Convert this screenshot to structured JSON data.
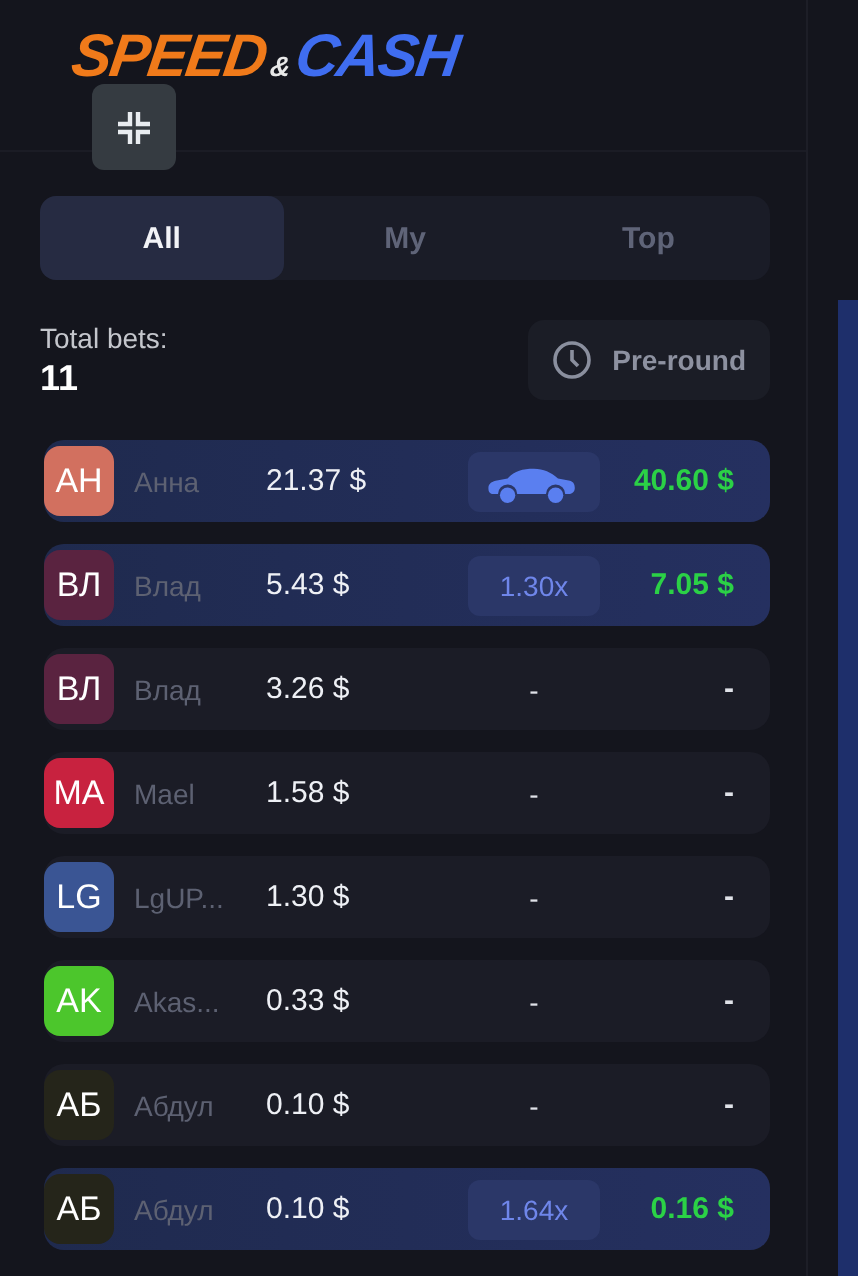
{
  "logo": {
    "left": "SPEED",
    "amp": "&",
    "right": "CASH"
  },
  "tabs": [
    {
      "label": "All",
      "selected": true
    },
    {
      "label": "My",
      "selected": false
    },
    {
      "label": "Top",
      "selected": false
    }
  ],
  "total_bets": {
    "label": "Total bets:",
    "value": "11"
  },
  "round_status": {
    "label": "Pre-round"
  },
  "bets": [
    {
      "initials": "АН",
      "color": "#d2705f",
      "name": "Анна",
      "bet": "21.37 $",
      "kind": "car",
      "payout": "40.60 $",
      "won": true
    },
    {
      "initials": "ВЛ",
      "color": "#5a2340",
      "name": "Влад",
      "bet": "5.43 $",
      "kind": "multiplier",
      "multiplier": "1.30x",
      "payout": "7.05 $",
      "won": true
    },
    {
      "initials": "ВЛ",
      "color": "#5a2340",
      "name": "Влад",
      "bet": "3.26 $",
      "kind": "plain",
      "multiplier": "-",
      "payout": "-",
      "won": false
    },
    {
      "initials": "MA",
      "color": "#c8223f",
      "name": "Mael",
      "bet": "1.58 $",
      "kind": "plain",
      "multiplier": "-",
      "payout": "-",
      "won": false
    },
    {
      "initials": "LG",
      "color": "#3a5594",
      "name": "LgUP...",
      "bet": "1.30 $",
      "kind": "plain",
      "multiplier": "-",
      "payout": "-",
      "won": false
    },
    {
      "initials": "AK",
      "color": "#4cc62c",
      "name": "Akas...",
      "bet": "0.33 $",
      "kind": "plain",
      "multiplier": "-",
      "payout": "-",
      "won": false
    },
    {
      "initials": "АБ",
      "color": "#25251a",
      "name": "Абдул",
      "bet": "0.10 $",
      "kind": "plain",
      "multiplier": "-",
      "payout": "-",
      "won": false
    },
    {
      "initials": "АБ",
      "color": "#25251a",
      "name": "Абдул",
      "bet": "0.10 $",
      "kind": "multiplier",
      "multiplier": "1.64x",
      "payout": "0.16 $",
      "won": true
    }
  ]
}
